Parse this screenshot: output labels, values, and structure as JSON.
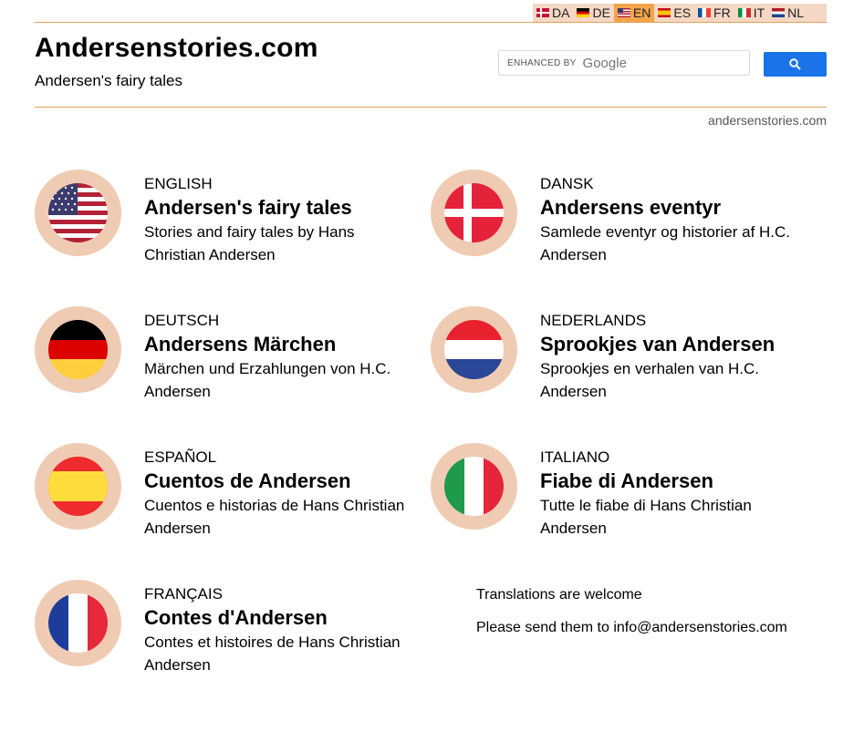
{
  "language_bar": [
    {
      "code": "DA",
      "flag": "dk"
    },
    {
      "code": "DE",
      "flag": "de"
    },
    {
      "code": "EN",
      "flag": "us",
      "active": true
    },
    {
      "code": "ES",
      "flag": "es"
    },
    {
      "code": "FR",
      "flag": "fr"
    },
    {
      "code": "IT",
      "flag": "it"
    },
    {
      "code": "NL",
      "flag": "nl"
    }
  ],
  "header": {
    "title": "Andersenstories.com",
    "subtitle": "Andersen's fairy tales"
  },
  "search": {
    "enhanced_label": "ENHANCED BY",
    "brand": "Google",
    "button_icon": "search-icon"
  },
  "domain_link": "andersenstories.com",
  "cards": [
    {
      "language": "ENGLISH",
      "title": "Andersen's fairy tales",
      "description": "Stories and fairy tales by Hans Christian Andersen",
      "flag": "us"
    },
    {
      "language": "DANSK",
      "title": "Andersens eventyr",
      "description": "Samlede eventyr og historier af H.C. Andersen",
      "flag": "dk"
    },
    {
      "language": "DEUTSCH",
      "title": "Andersens Märchen",
      "description": "Märchen und Erzahlungen von H.C. Andersen",
      "flag": "de"
    },
    {
      "language": "NEDERLANDS",
      "title": "Sprookjes van Andersen",
      "description": "Sprookjes en verhalen van H.C. Andersen",
      "flag": "nl"
    },
    {
      "language": "ESPAÑOL",
      "title": "Cuentos de Andersen",
      "description": "Cuentos e historias de Hans Christian Andersen",
      "flag": "es"
    },
    {
      "language": "ITALIANO",
      "title": "Fiabe di Andersen",
      "description": "Tutte le fiabe di Hans Christian Andersen",
      "flag": "it"
    },
    {
      "language": "FRANÇAIS",
      "title": "Contes d'Andersen",
      "description": "Contes et histoires de Hans Christian Andersen",
      "flag": "fr"
    }
  ],
  "translations": {
    "line1": "Translations are welcome",
    "line2": "Please send them to info@andersenstories.com"
  },
  "colors": {
    "accent_line": "#e0a35a",
    "lang_bar_bg": "#f4d7c4",
    "lang_active_bg": "#f2a54a",
    "flag_ring": "#f0cbb3",
    "search_button": "#1a73e8"
  }
}
